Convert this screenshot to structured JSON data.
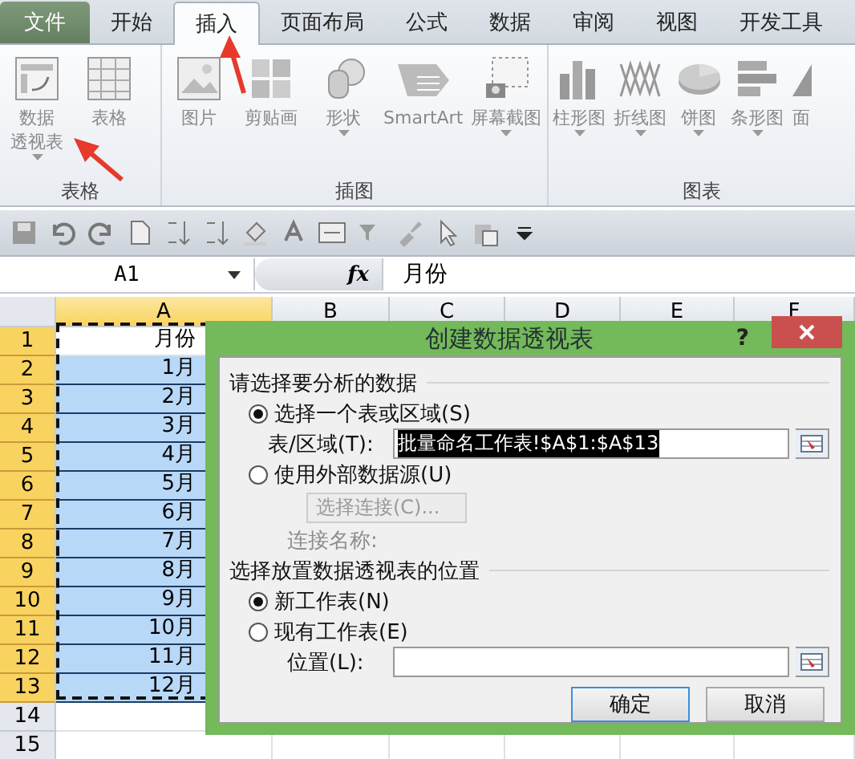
{
  "ribbon_tabs": [
    {
      "label": "文件",
      "kind": "file",
      "selected": false
    },
    {
      "label": "开始",
      "kind": "tab",
      "selected": false
    },
    {
      "label": "插入",
      "kind": "tab",
      "selected": true
    },
    {
      "label": "页面布局",
      "kind": "tab",
      "selected": false
    },
    {
      "label": "公式",
      "kind": "tab",
      "selected": false
    },
    {
      "label": "数据",
      "kind": "tab",
      "selected": false
    },
    {
      "label": "审阅",
      "kind": "tab",
      "selected": false
    },
    {
      "label": "视图",
      "kind": "tab",
      "selected": false
    },
    {
      "label": "开发工具",
      "kind": "tab",
      "selected": false
    }
  ],
  "ribbon_groups": [
    {
      "label": "表格",
      "buttons": [
        {
          "lines": [
            "数据",
            "透视表"
          ],
          "dropdown": true
        },
        {
          "lines": [
            "表格"
          ],
          "dropdown": false
        }
      ]
    },
    {
      "label": "插图",
      "buttons": [
        {
          "lines": [
            "图片"
          ],
          "dropdown": false
        },
        {
          "lines": [
            "剪贴画"
          ],
          "dropdown": false
        },
        {
          "lines": [
            "形状"
          ],
          "dropdown": true
        },
        {
          "lines": [
            "SmartArt"
          ],
          "dropdown": false
        },
        {
          "lines": [
            "屏幕截图"
          ],
          "dropdown": true
        }
      ]
    },
    {
      "label": "图表",
      "buttons": [
        {
          "lines": [
            "柱形图"
          ],
          "dropdown": true
        },
        {
          "lines": [
            "折线图"
          ],
          "dropdown": true
        },
        {
          "lines": [
            "饼图"
          ],
          "dropdown": true
        },
        {
          "lines": [
            "条形图"
          ],
          "dropdown": true
        },
        {
          "lines": [
            "面"
          ],
          "dropdown": false
        }
      ]
    }
  ],
  "formula_bar": {
    "name_box": "A1",
    "fx": "fx",
    "content": "月份"
  },
  "columns": [
    {
      "label": "A",
      "selected": true
    },
    {
      "label": "B",
      "selected": false
    },
    {
      "label": "C",
      "selected": false
    },
    {
      "label": "D",
      "selected": false
    },
    {
      "label": "E",
      "selected": false
    },
    {
      "label": "F",
      "selected": false
    }
  ],
  "rows": [
    {
      "number": "1",
      "selected": true,
      "a": "月份",
      "highlighted": false
    },
    {
      "number": "2",
      "selected": true,
      "a": "1月",
      "highlighted": true
    },
    {
      "number": "3",
      "selected": true,
      "a": "2月",
      "highlighted": true
    },
    {
      "number": "4",
      "selected": true,
      "a": "3月",
      "highlighted": true
    },
    {
      "number": "5",
      "selected": true,
      "a": "4月",
      "highlighted": true
    },
    {
      "number": "6",
      "selected": true,
      "a": "5月",
      "highlighted": true
    },
    {
      "number": "7",
      "selected": true,
      "a": "6月",
      "highlighted": true
    },
    {
      "number": "8",
      "selected": true,
      "a": "7月",
      "highlighted": true
    },
    {
      "number": "9",
      "selected": true,
      "a": "8月",
      "highlighted": true
    },
    {
      "number": "10",
      "selected": true,
      "a": "9月",
      "highlighted": true
    },
    {
      "number": "11",
      "selected": true,
      "a": "10月",
      "highlighted": true
    },
    {
      "number": "12",
      "selected": true,
      "a": "11月",
      "highlighted": true
    },
    {
      "number": "13",
      "selected": true,
      "a": "12月",
      "highlighted": true
    },
    {
      "number": "14",
      "selected": false,
      "a": "",
      "highlighted": false
    },
    {
      "number": "15",
      "selected": false,
      "a": "",
      "highlighted": false
    }
  ],
  "dialog": {
    "title": "创建数据透视表",
    "help": "?",
    "section_1": "请选择要分析的数据",
    "source_options": [
      {
        "label": "选择一个表或区域(S)",
        "selected": true
      },
      {
        "label": "使用外部数据源(U)",
        "selected": false
      }
    ],
    "range_label": "表/区域(T):",
    "range_value": "批量命名工作表!$A$1:$A$13",
    "range_value_highlighted": true,
    "connection_button": {
      "label": "选择连接(C)...",
      "disabled": true
    },
    "connection_name": {
      "label": "连接名称:",
      "disabled": true
    },
    "section_2": "选择放置数据透视表的位置",
    "target_options": [
      {
        "label": "新工作表(N)",
        "selected": true
      },
      {
        "label": "现有工作表(E)",
        "selected": false
      }
    ],
    "location_label": "位置(L):",
    "buttons": [
      {
        "label": "确定",
        "default": true
      },
      {
        "label": "取消",
        "default": false
      }
    ]
  },
  "annotations": [
    {
      "kind": "arrow"
    },
    {
      "kind": "arrow"
    }
  ]
}
